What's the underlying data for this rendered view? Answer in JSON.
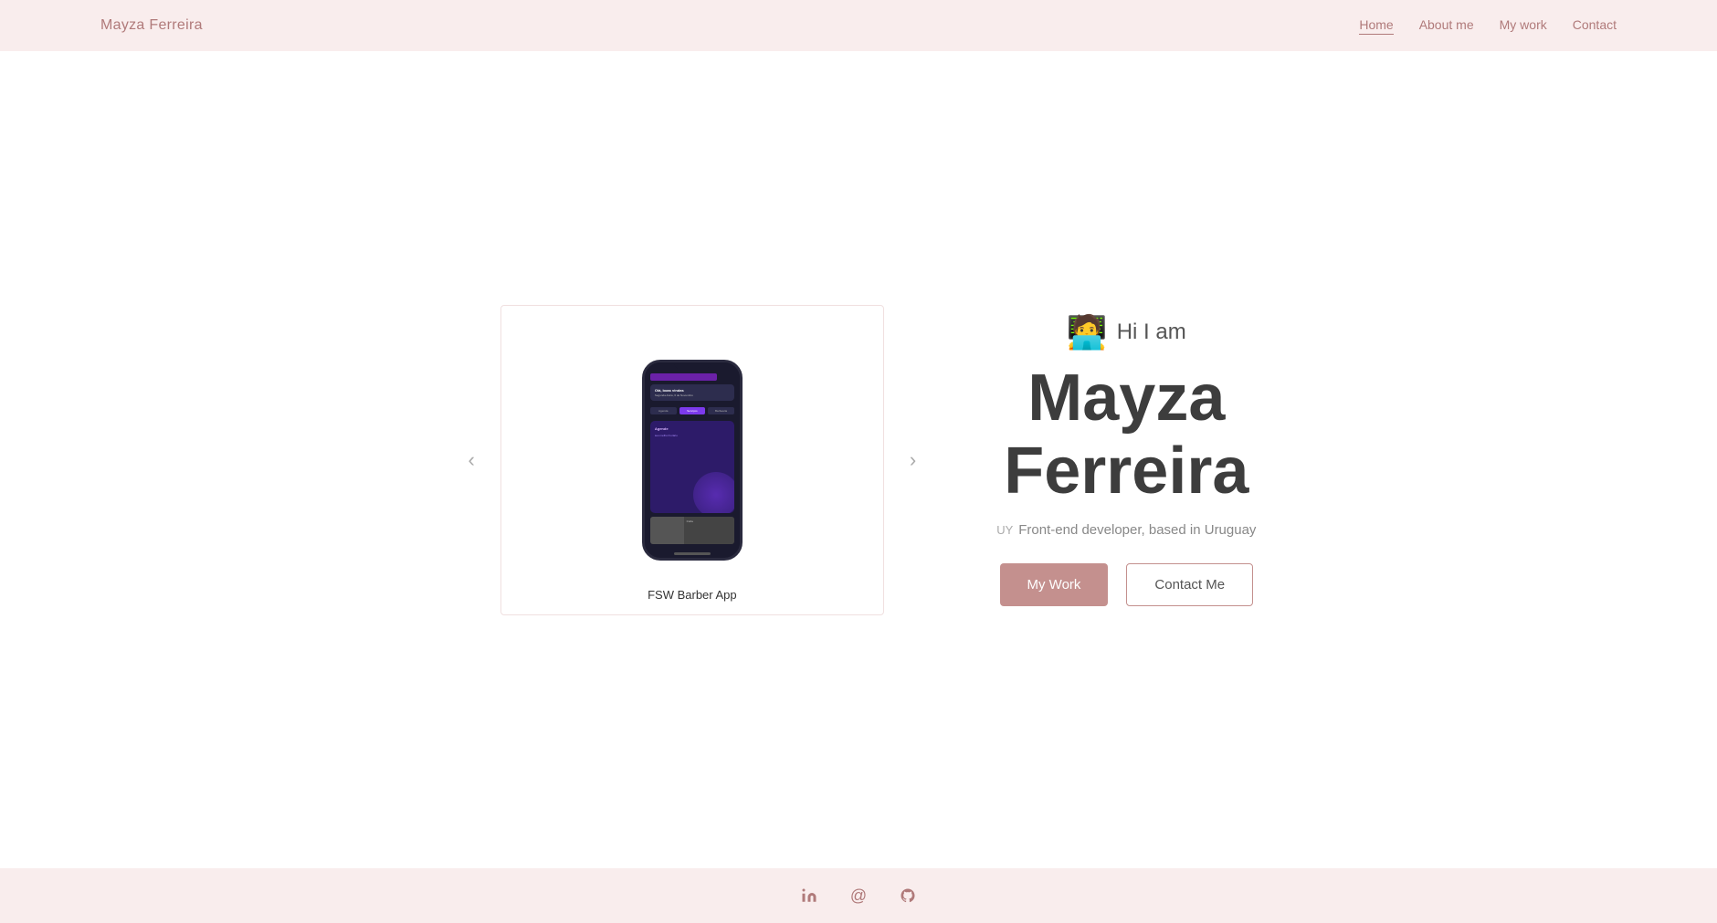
{
  "navbar": {
    "brand": "Mayza Ferreira",
    "links": [
      {
        "label": "Home",
        "href": "#",
        "active": true
      },
      {
        "label": "About me",
        "href": "#about"
      },
      {
        "label": "My work",
        "href": "#work"
      },
      {
        "label": "Contact",
        "href": "#contact"
      }
    ]
  },
  "carousel": {
    "prev_label": "‹",
    "next_label": "›",
    "caption": "FSW Barber App"
  },
  "hero": {
    "greeting": "Hi I am",
    "emoji": "🧑‍💻",
    "name_line1": "Mayza",
    "name_line2": "Ferreira",
    "subtitle_flag": "UY",
    "subtitle": "Front-end developer, based in Uruguay",
    "btn_work": "My Work",
    "btn_contact": "Contact Me"
  },
  "footer": {
    "icons": [
      {
        "name": "linkedin-icon",
        "symbol": "in",
        "label": "LinkedIn"
      },
      {
        "name": "email-icon",
        "symbol": "@",
        "label": "Email"
      },
      {
        "name": "github-icon",
        "symbol": "⊙",
        "label": "GitHub"
      }
    ]
  }
}
